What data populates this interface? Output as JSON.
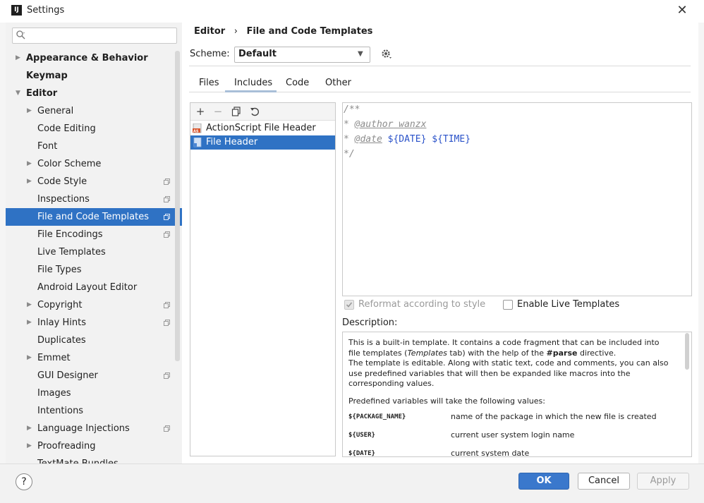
{
  "window": {
    "title": "Settings",
    "app_icon_text": "IJ"
  },
  "search": {
    "placeholder": ""
  },
  "tree": [
    {
      "label": "Appearance & Behavior",
      "level": 0,
      "arrow": "▶",
      "bold": true
    },
    {
      "label": "Keymap",
      "level": 0,
      "arrow": "",
      "bold": true
    },
    {
      "label": "Editor",
      "level": 0,
      "arrow": "▼",
      "bold": true
    },
    {
      "label": "General",
      "level": 1,
      "arrow": "▶"
    },
    {
      "label": "Code Editing",
      "level": 1,
      "arrow": ""
    },
    {
      "label": "Font",
      "level": 1,
      "arrow": ""
    },
    {
      "label": "Color Scheme",
      "level": 1,
      "arrow": "▶"
    },
    {
      "label": "Code Style",
      "level": 1,
      "arrow": "▶",
      "project": true
    },
    {
      "label": "Inspections",
      "level": 1,
      "arrow": "",
      "project": true
    },
    {
      "label": "File and Code Templates",
      "level": 1,
      "arrow": "",
      "project": true,
      "selected": true
    },
    {
      "label": "File Encodings",
      "level": 1,
      "arrow": "",
      "project": true
    },
    {
      "label": "Live Templates",
      "level": 1,
      "arrow": ""
    },
    {
      "label": "File Types",
      "level": 1,
      "arrow": ""
    },
    {
      "label": "Android Layout Editor",
      "level": 1,
      "arrow": ""
    },
    {
      "label": "Copyright",
      "level": 1,
      "arrow": "▶",
      "project": true
    },
    {
      "label": "Inlay Hints",
      "level": 1,
      "arrow": "▶",
      "project": true
    },
    {
      "label": "Duplicates",
      "level": 1,
      "arrow": ""
    },
    {
      "label": "Emmet",
      "level": 1,
      "arrow": "▶"
    },
    {
      "label": "GUI Designer",
      "level": 1,
      "arrow": "",
      "project": true
    },
    {
      "label": "Images",
      "level": 1,
      "arrow": ""
    },
    {
      "label": "Intentions",
      "level": 1,
      "arrow": ""
    },
    {
      "label": "Language Injections",
      "level": 1,
      "arrow": "▶",
      "project": true
    },
    {
      "label": "Proofreading",
      "level": 1,
      "arrow": "▶"
    },
    {
      "label": "TextMate Bundles",
      "level": 1,
      "arrow": ""
    }
  ],
  "breadcrumb": {
    "part1": "Editor",
    "sep": "›",
    "part2": "File and Code Templates"
  },
  "scheme": {
    "label": "Scheme:",
    "value": "Default"
  },
  "tabs": [
    "Files",
    "Includes",
    "Code",
    "Other"
  ],
  "active_tab": "Includes",
  "list": [
    {
      "label": "ActionScript File Header",
      "icon": "actionscript-icon",
      "selected": false
    },
    {
      "label": "File Header",
      "icon": "file-header-icon",
      "selected": true
    }
  ],
  "editor": {
    "l1": "/**",
    "l2_star": "* ",
    "l2_tag": "@author",
    "l2_val": " wanzx",
    "l3_star": "* ",
    "l3_tag": "@date",
    "l3_v1": " ${DATE}",
    "l3_v2": " ${TIME}",
    "l4": "*/"
  },
  "options": {
    "reformat": "Reformat according to style",
    "live_templates": "Enable Live Templates"
  },
  "description": {
    "label": "Description:",
    "p1_a": "This is a built-in template. It contains a code fragment that can be included into file templates (",
    "p1_em": "Templates",
    "p1_b": " tab) with the help of the ",
    "p1_strong": "#parse",
    "p1_c": " directive.",
    "p2": "The template is editable. Along with static text, code and comments, you can also use predefined variables that will then be expanded like macros into the corresponding values.",
    "p3": "Predefined variables will take the following values:",
    "vars": [
      {
        "name": "${PACKAGE_NAME}",
        "desc": "name of the package in which the new file is created"
      },
      {
        "name": "${USER}",
        "desc": "current user system login name"
      },
      {
        "name": "${DATE}",
        "desc": "current system date"
      }
    ]
  },
  "footer": {
    "help": "?",
    "ok": "OK",
    "cancel": "Cancel",
    "apply": "Apply"
  },
  "colors": {
    "selection": "#2f72c4",
    "ok_button": "#3a78cc",
    "variable": "#2a52c9"
  }
}
